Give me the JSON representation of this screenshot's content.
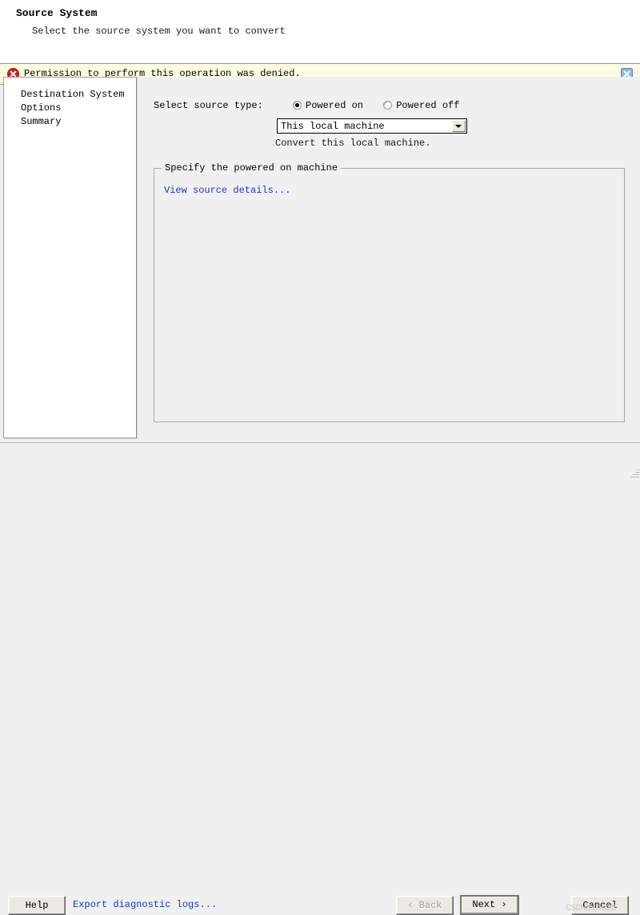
{
  "header": {
    "title": "Source System",
    "subtitle": "Select the source system you want to convert"
  },
  "banner": {
    "message": "Permission to perform this operation was denied.",
    "icon": "error-circle-icon",
    "close_icon": "close-icon",
    "background_color": "#fdfbe2",
    "icon_color": "#cc2222",
    "close_color": "#7ba7d7"
  },
  "sidebar": {
    "items": [
      {
        "label": "Destination System"
      },
      {
        "label": "Options"
      },
      {
        "label": "Summary"
      }
    ]
  },
  "main": {
    "source_type_label": "Select source type:",
    "radios": [
      {
        "label": "Powered on",
        "selected": true
      },
      {
        "label": "Powered off",
        "selected": false
      }
    ],
    "combo": {
      "value": "This local machine",
      "arrow_icon": "chevron-down-icon"
    },
    "combo_hint": "Convert this local machine.",
    "groupbox": {
      "legend": "Specify the powered on machine",
      "link": "View source details..."
    }
  },
  "footer": {
    "help_label": "Help",
    "export_link": "Export diagnostic logs...",
    "back_label": "‹  Back",
    "next_label": "Next  ›",
    "cancel_label": "Cancel",
    "watermark": "CSDN@xh928"
  },
  "colors": {
    "link": "#1736c8",
    "content_bg": "#f0f0f0",
    "panel_bg": "#ffffff"
  }
}
